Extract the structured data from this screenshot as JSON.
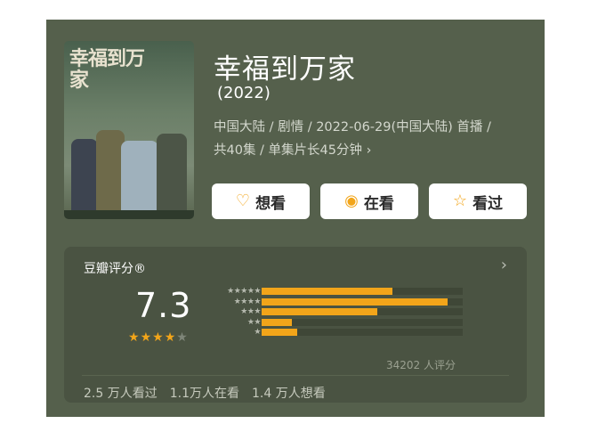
{
  "movie": {
    "poster_title": "幸福到万家",
    "title": "幸福到万家",
    "year": "(2022)",
    "meta_line1": "中国大陆 / 剧情 / 2022-06-29(中国大陆) 首播 /",
    "meta_line2": "共40集 / 单集片长45分钟",
    "meta_chevron": "›"
  },
  "buttons": [
    {
      "label": "想看",
      "icon": "heart-plus-icon",
      "glyph": "♡"
    },
    {
      "label": "在看",
      "icon": "target-icon",
      "glyph": "◉"
    },
    {
      "label": "看过",
      "icon": "star-outline-icon",
      "glyph": "☆"
    }
  ],
  "rating": {
    "label": "豆瓣评分®",
    "chevron": "›",
    "score": "7.3",
    "stars_filled": 3.5,
    "stars_total": 5,
    "distribution": [
      {
        "stars": "★★★★★",
        "percent": 26
      },
      {
        "stars": "★★★★",
        "percent": 37
      },
      {
        "stars": "★★★",
        "percent": 23
      },
      {
        "stars": "★★",
        "percent": 6
      },
      {
        "stars": "★",
        "percent": 7
      }
    ],
    "count_text": "34202 人评分",
    "stats": [
      "2.5 万人看过",
      "1.1万人在看",
      "1.4 万人想看"
    ]
  },
  "colors": {
    "card_bg": "#55604c",
    "rating_bg": "#4a5342",
    "accent": "#f2a51a"
  }
}
